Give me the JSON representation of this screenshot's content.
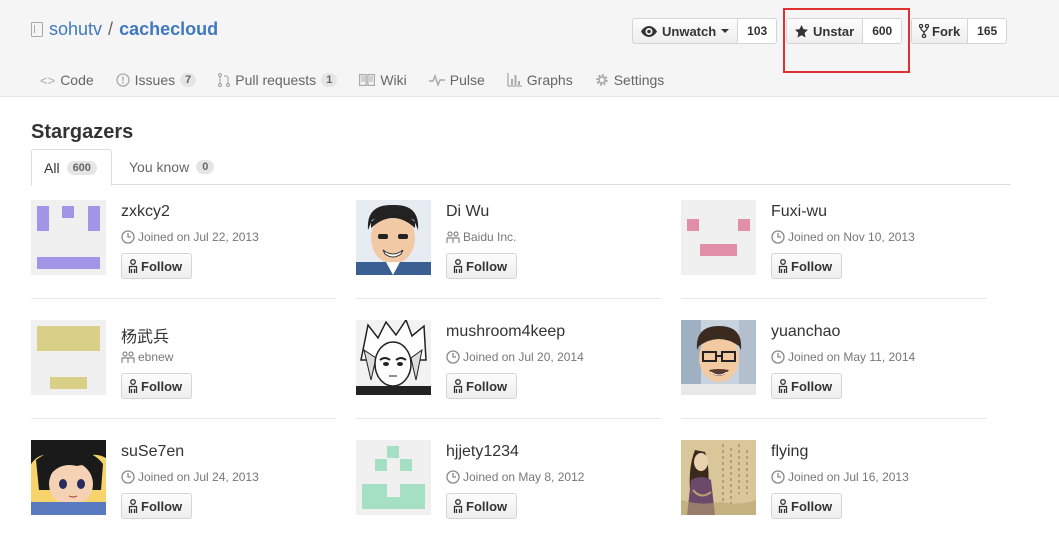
{
  "repo": {
    "owner": "sohutv",
    "separator": "/",
    "name": "cachecloud"
  },
  "actions": {
    "watch": {
      "label": "Unwatch",
      "count": "103"
    },
    "star": {
      "label": "Unstar",
      "count": "600"
    },
    "fork": {
      "label": "Fork",
      "count": "165"
    }
  },
  "nav": {
    "code": "Code",
    "issues": "Issues",
    "issues_count": "7",
    "pulls": "Pull requests",
    "pulls_count": "1",
    "wiki": "Wiki",
    "pulse": "Pulse",
    "graphs": "Graphs",
    "settings": "Settings"
  },
  "page_title": "Stargazers",
  "tabs": {
    "all": "All",
    "all_count": "600",
    "you_know": "You know",
    "you_know_count": "0"
  },
  "follow_label": "Follow",
  "users": [
    {
      "name": "zxkcy2",
      "meta": "Joined on Jul 22, 2013",
      "meta_icon": "clock-icon"
    },
    {
      "name": "Di Wu",
      "meta": "Baidu Inc.",
      "meta_icon": "organization-icon"
    },
    {
      "name": "Fuxi-wu",
      "meta": "Joined on Nov 10, 2013",
      "meta_icon": "clock-icon"
    },
    {
      "name": "杨武兵",
      "meta": "ebnew",
      "meta_icon": "organization-icon"
    },
    {
      "name": "mushroom4keep",
      "meta": "Joined on Jul 20, 2014",
      "meta_icon": "clock-icon"
    },
    {
      "name": "yuanchao",
      "meta": "Joined on May 11, 2014",
      "meta_icon": "clock-icon"
    },
    {
      "name": "suSe7en",
      "meta": "Joined on Jul 24, 2013",
      "meta_icon": "clock-icon"
    },
    {
      "name": "hjjety1234",
      "meta": "Joined on May 8, 2012",
      "meta_icon": "clock-icon"
    },
    {
      "name": "flying",
      "meta": "Joined on Jul 16, 2013",
      "meta_icon": "clock-icon"
    }
  ],
  "colors": {
    "link": "#4078c0",
    "highlight": "#e03131",
    "identicon_zxkcy2": "#a294e6",
    "identicon_fuxi": "#e08fa6",
    "identicon_yang": "#d9cf86",
    "identicon_hjjety": "#a6e0c4"
  }
}
